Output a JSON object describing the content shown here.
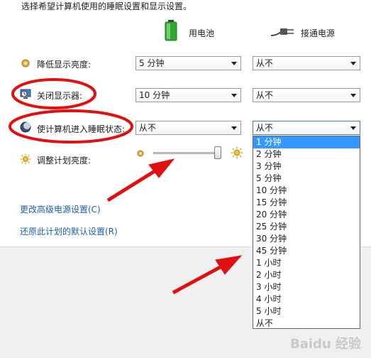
{
  "heading": "选择希望计算机使用的睡眠设置和显示设置。",
  "columns": {
    "battery": "用电池",
    "plugged": "接通电源"
  },
  "rows": {
    "dim": {
      "label": "降低显示亮度:",
      "battery": "5 分钟",
      "plugged": "从不"
    },
    "display_off": {
      "label": "关闭显示器:",
      "battery": "10 分钟",
      "plugged": "从不"
    },
    "sleep": {
      "label": "使计算机进入睡眠状态:",
      "battery": "从不",
      "plugged": "从不"
    },
    "brightness": {
      "label": "调整计划亮度:",
      "battery_level": 1.0
    }
  },
  "links": {
    "advanced": "更改高级电源设置(C)",
    "restore": "还原此计划的默认设置(R)"
  },
  "dropdown_options": [
    "1 分钟",
    "2 分钟",
    "3 分钟",
    "5 分钟",
    "10 分钟",
    "15 分钟",
    "20 分钟",
    "25 分钟",
    "30 分钟",
    "45 分钟",
    "1 小时",
    "2 小时",
    "3 小时",
    "4 小时",
    "5 小时",
    "从不"
  ],
  "dropdown_selected_index": 0,
  "watermark": "Baidu 经验",
  "colors": {
    "selection": "#3399ff",
    "link": "#1c5fa8",
    "annotation_red": "#e01010"
  }
}
